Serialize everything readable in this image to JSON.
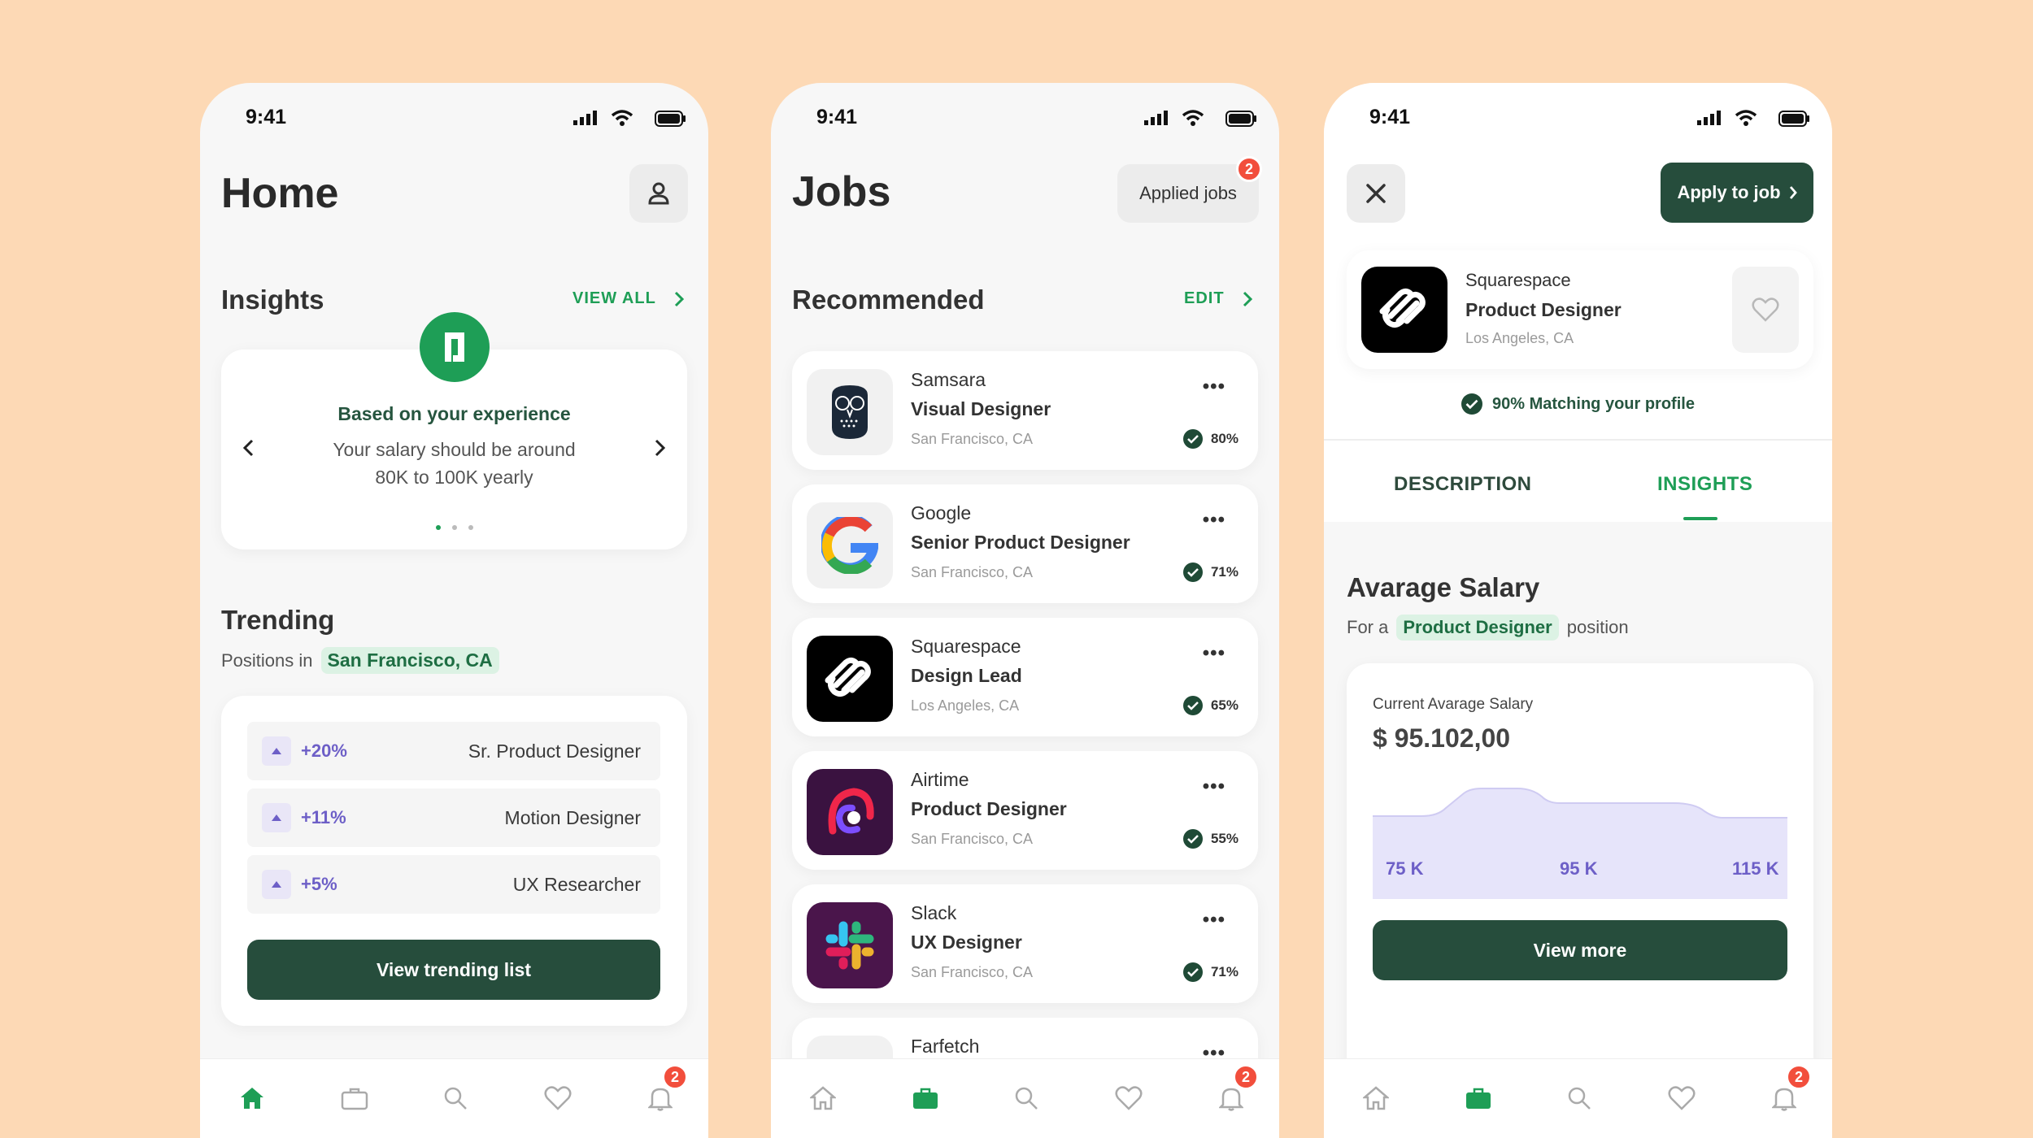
{
  "status": {
    "time": "9:41"
  },
  "colors": {
    "background": "#FDD9B5",
    "accent_green": "#1E9E56",
    "dark_green": "#264D3C",
    "purple": "#6D5FC7",
    "badge_red": "#F24E3C"
  },
  "home": {
    "title": "Home",
    "insights": {
      "heading": "Insights",
      "view_all": "VIEW ALL",
      "card_title": "Based on your experience",
      "card_line1": "Your salary should be around",
      "card_line2": "80K to 100K yearly"
    },
    "trending": {
      "heading": "Trending",
      "sub_prefix": "Positions in",
      "location": "San Francisco, CA",
      "rows": [
        {
          "pct": "+20%",
          "role": "Sr. Product Designer"
        },
        {
          "pct": "+11%",
          "role": "Motion Designer"
        },
        {
          "pct": "+5%",
          "role": "UX Researcher"
        }
      ],
      "button": "View trending list"
    },
    "nav_badge": "2"
  },
  "jobs": {
    "title": "Jobs",
    "applied_label": "Applied jobs",
    "applied_count": "2",
    "recommended": "Recommended",
    "edit": "EDIT",
    "items": [
      {
        "company": "Samsara",
        "title": "Visual Designer",
        "location": "San Francisco, CA",
        "match": "80%",
        "logo_icon": "owl-icon"
      },
      {
        "company": "Google",
        "title": "Senior Product Designer",
        "location": "San Francisco, CA",
        "match": "71%",
        "logo_icon": "google-icon"
      },
      {
        "company": "Squarespace",
        "title": "Design Lead",
        "location": "Los Angeles, CA",
        "match": "65%",
        "logo_icon": "squarespace-icon"
      },
      {
        "company": "Airtime",
        "title": "Product Designer",
        "location": "San Francisco, CA",
        "match": "55%",
        "logo_icon": "airtime-icon"
      },
      {
        "company": "Slack",
        "title": "UX Designer",
        "location": "San Francisco, CA",
        "match": "71%",
        "logo_icon": "slack-icon"
      },
      {
        "company": "Farfetch"
      }
    ],
    "nav_badge": "2"
  },
  "detail": {
    "apply": "Apply to job",
    "company": "Squarespace",
    "title": "Product Designer",
    "location": "Los Angeles, CA",
    "matching": "90% Matching your profile",
    "tabs": [
      "DESCRIPTION",
      "INSIGHTS"
    ],
    "active_tab": "INSIGHTS",
    "salary_heading": "Avarage Salary",
    "for_prefix": "For a",
    "for_role": "Product Designer",
    "for_suffix": "position",
    "current_label": "Current Avarage Salary",
    "current_value": "$ 95.102,00",
    "chart_labels": [
      "75 K",
      "95 K",
      "115 K"
    ],
    "view_more": "View more",
    "nav_badge": "2"
  }
}
